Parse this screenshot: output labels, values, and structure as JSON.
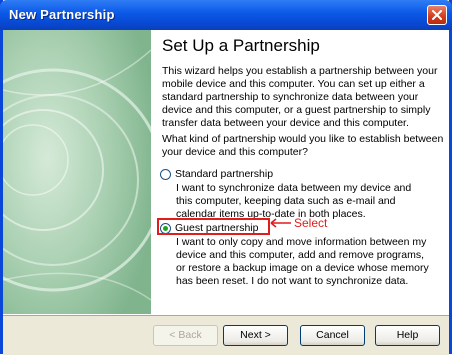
{
  "window": {
    "title": "New Partnership"
  },
  "wizard": {
    "heading": "Set Up a Partnership",
    "intro_lines": [
      "This wizard helps you establish a partnership between your",
      "mobile device and this computer.  You can set up either a",
      "standard partnership to synchronize data between your",
      "device and this computer, or a guest partnership to simply",
      "transfer data between your device and this computer."
    ],
    "question_lines": [
      "What kind of partnership would you like to establish between",
      "your device and this computer?"
    ],
    "options": [
      {
        "label": "Standard partnership",
        "selected": false,
        "description_lines": [
          "I want to synchronize data between my device and",
          "this computer, keeping data such as e-mail and",
          "calendar items up-to-date in both places."
        ]
      },
      {
        "label": "Guest partnership",
        "selected": true,
        "description_lines": [
          "I want to only copy and move information between my",
          "device and this computer, add and remove programs,",
          "or restore a backup image on a device whose memory",
          "has been reset. I do not want to synchronize data."
        ]
      }
    ],
    "annotation": "Select"
  },
  "buttons": {
    "back": "< Back",
    "next": "Next >",
    "cancel": "Cancel",
    "help": "Help"
  },
  "colors": {
    "titlebar": "#0a58e6",
    "panel": "#9fc9a8",
    "annotation": "#e01c1c"
  }
}
